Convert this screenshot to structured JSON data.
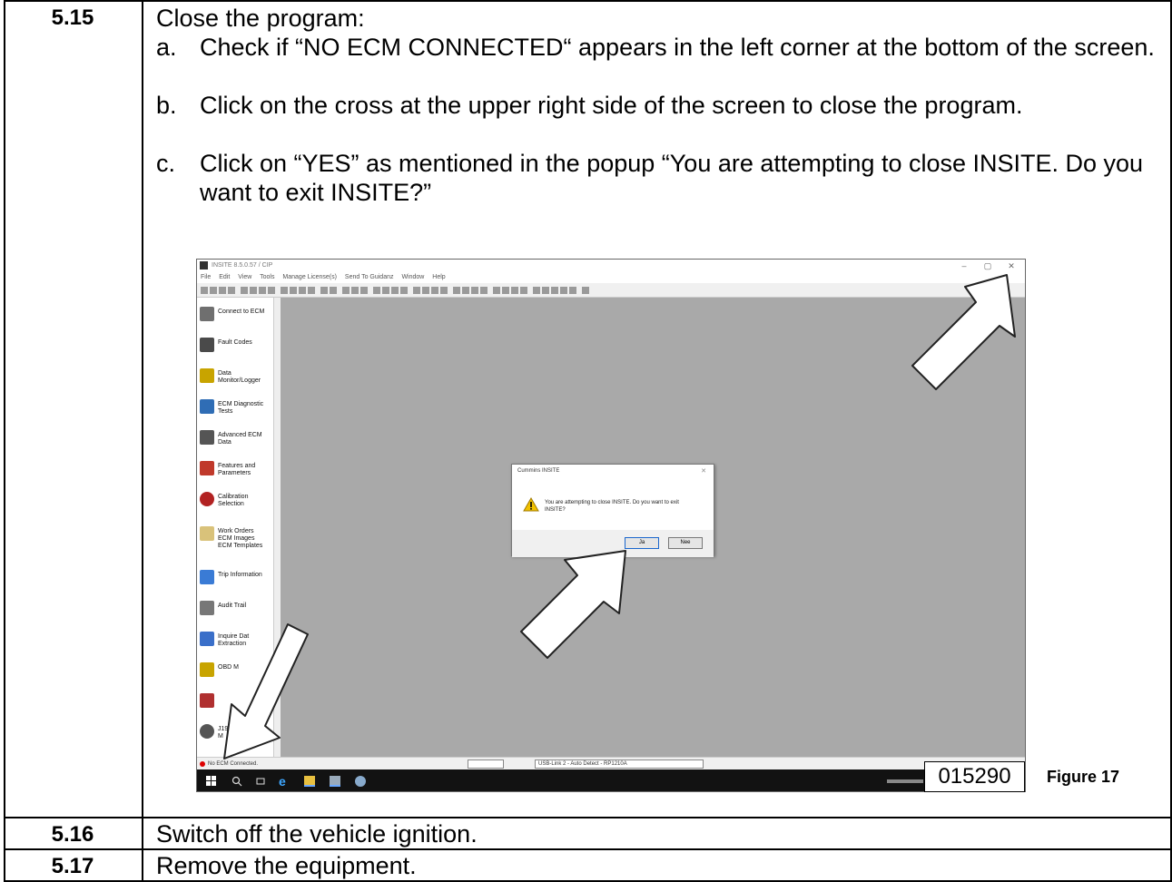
{
  "steps": {
    "s515": {
      "number": "5.15",
      "title": "Close the program:",
      "items": [
        {
          "letter": "a.",
          "text": "Check if “NO ECM CONNECTED“ appears in the left corner at the bottom of the screen."
        },
        {
          "letter": "b.",
          "text": "Click on the cross at the upper right side of the screen to close the program."
        },
        {
          "letter": "c.",
          "text": "Click on “YES” as mentioned in the popup “You are attempting to close INSITE. Do you want to exit INSITE?”"
        }
      ]
    },
    "s516": {
      "number": "5.16",
      "text": "Switch off the vehicle ignition."
    },
    "s517": {
      "number": "5.17",
      "text": "Remove the equipment."
    }
  },
  "figure": {
    "window_title": "INSITE 8.5.0.57 / CIP",
    "menu": [
      "File",
      "Edit",
      "View",
      "Tools",
      "Manage License(s)",
      "Send To Guidanz",
      "Window",
      "Help"
    ],
    "window_controls": {
      "minimize": "–",
      "maximize": "▢",
      "close": "✕"
    },
    "sidebar": [
      {
        "label": "Connect to ECM",
        "color": "#6f6f6f"
      },
      {
        "label": "Fault Codes",
        "color": "#4a4a4a"
      },
      {
        "label": "Data\nMonitor/Logger",
        "color": "#c8a400"
      },
      {
        "label": "ECM Diagnostic\nTests",
        "color": "#2f6db5"
      },
      {
        "label": "Advanced ECM\nData",
        "color": "#555555"
      },
      {
        "label": "Features and\nParameters",
        "color": "#c0392b"
      },
      {
        "label": "Calibration\nSelection",
        "color": "#b22222"
      },
      {
        "label": "Work Orders\nECM Images\nECM Templates",
        "color": "#d9c27a"
      },
      {
        "label": "Trip Information",
        "color": "#3a7bd5"
      },
      {
        "label": "Audit Trail",
        "color": "#777777"
      },
      {
        "label": "Inquire Dat\nExtraction",
        "color": "#3a6fc9"
      },
      {
        "label": "OBD M",
        "color": "#c8a400"
      },
      {
        "label": "J19\nM",
        "color": "#555555"
      }
    ],
    "status": {
      "connection": "No ECM Connected.",
      "adapter": "USB-Link 2 - Auto Detect - RP1210A"
    },
    "dialog": {
      "title": "Cummins INSITE",
      "close": "✕",
      "message": "You are attempting to close INSITE. Do you want to exit INSITE?",
      "yes": "Ja",
      "no": "Nee"
    },
    "code": "015290",
    "caption": "Figure 17"
  }
}
